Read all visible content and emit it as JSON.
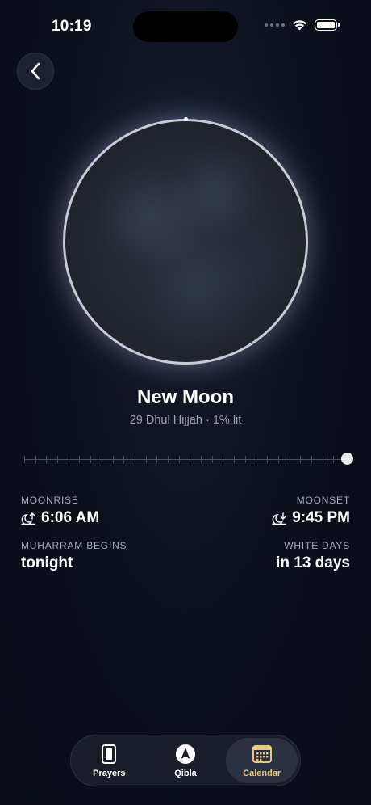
{
  "status_bar": {
    "time": "10:19"
  },
  "moon": {
    "phase_name": "New Moon",
    "subtitle": "29 Dhul Hijjah · 1% lit",
    "illumination_fraction": 0.01
  },
  "timeline": {
    "position_fraction": 1.0
  },
  "details": {
    "moonrise": {
      "label": "MOONRISE",
      "value": "6:06 AM"
    },
    "moonset": {
      "label": "MOONSET",
      "value": "9:45 PM"
    },
    "muharram": {
      "label": "MUHARRAM BEGINS",
      "value": "tonight"
    },
    "white_days": {
      "label": "WHITE DAYS",
      "value": "in 13 days"
    }
  },
  "tab_bar": {
    "tabs": [
      {
        "label": "Prayers",
        "icon": "phone-icon",
        "active": false
      },
      {
        "label": "Qibla",
        "icon": "compass-arrow-icon",
        "active": false
      },
      {
        "label": "Calendar",
        "icon": "calendar-icon",
        "active": true
      }
    ]
  },
  "colors": {
    "background": "#0c0f1c",
    "accent": "#e9c97a",
    "secondary_text": "#a7abb8"
  }
}
